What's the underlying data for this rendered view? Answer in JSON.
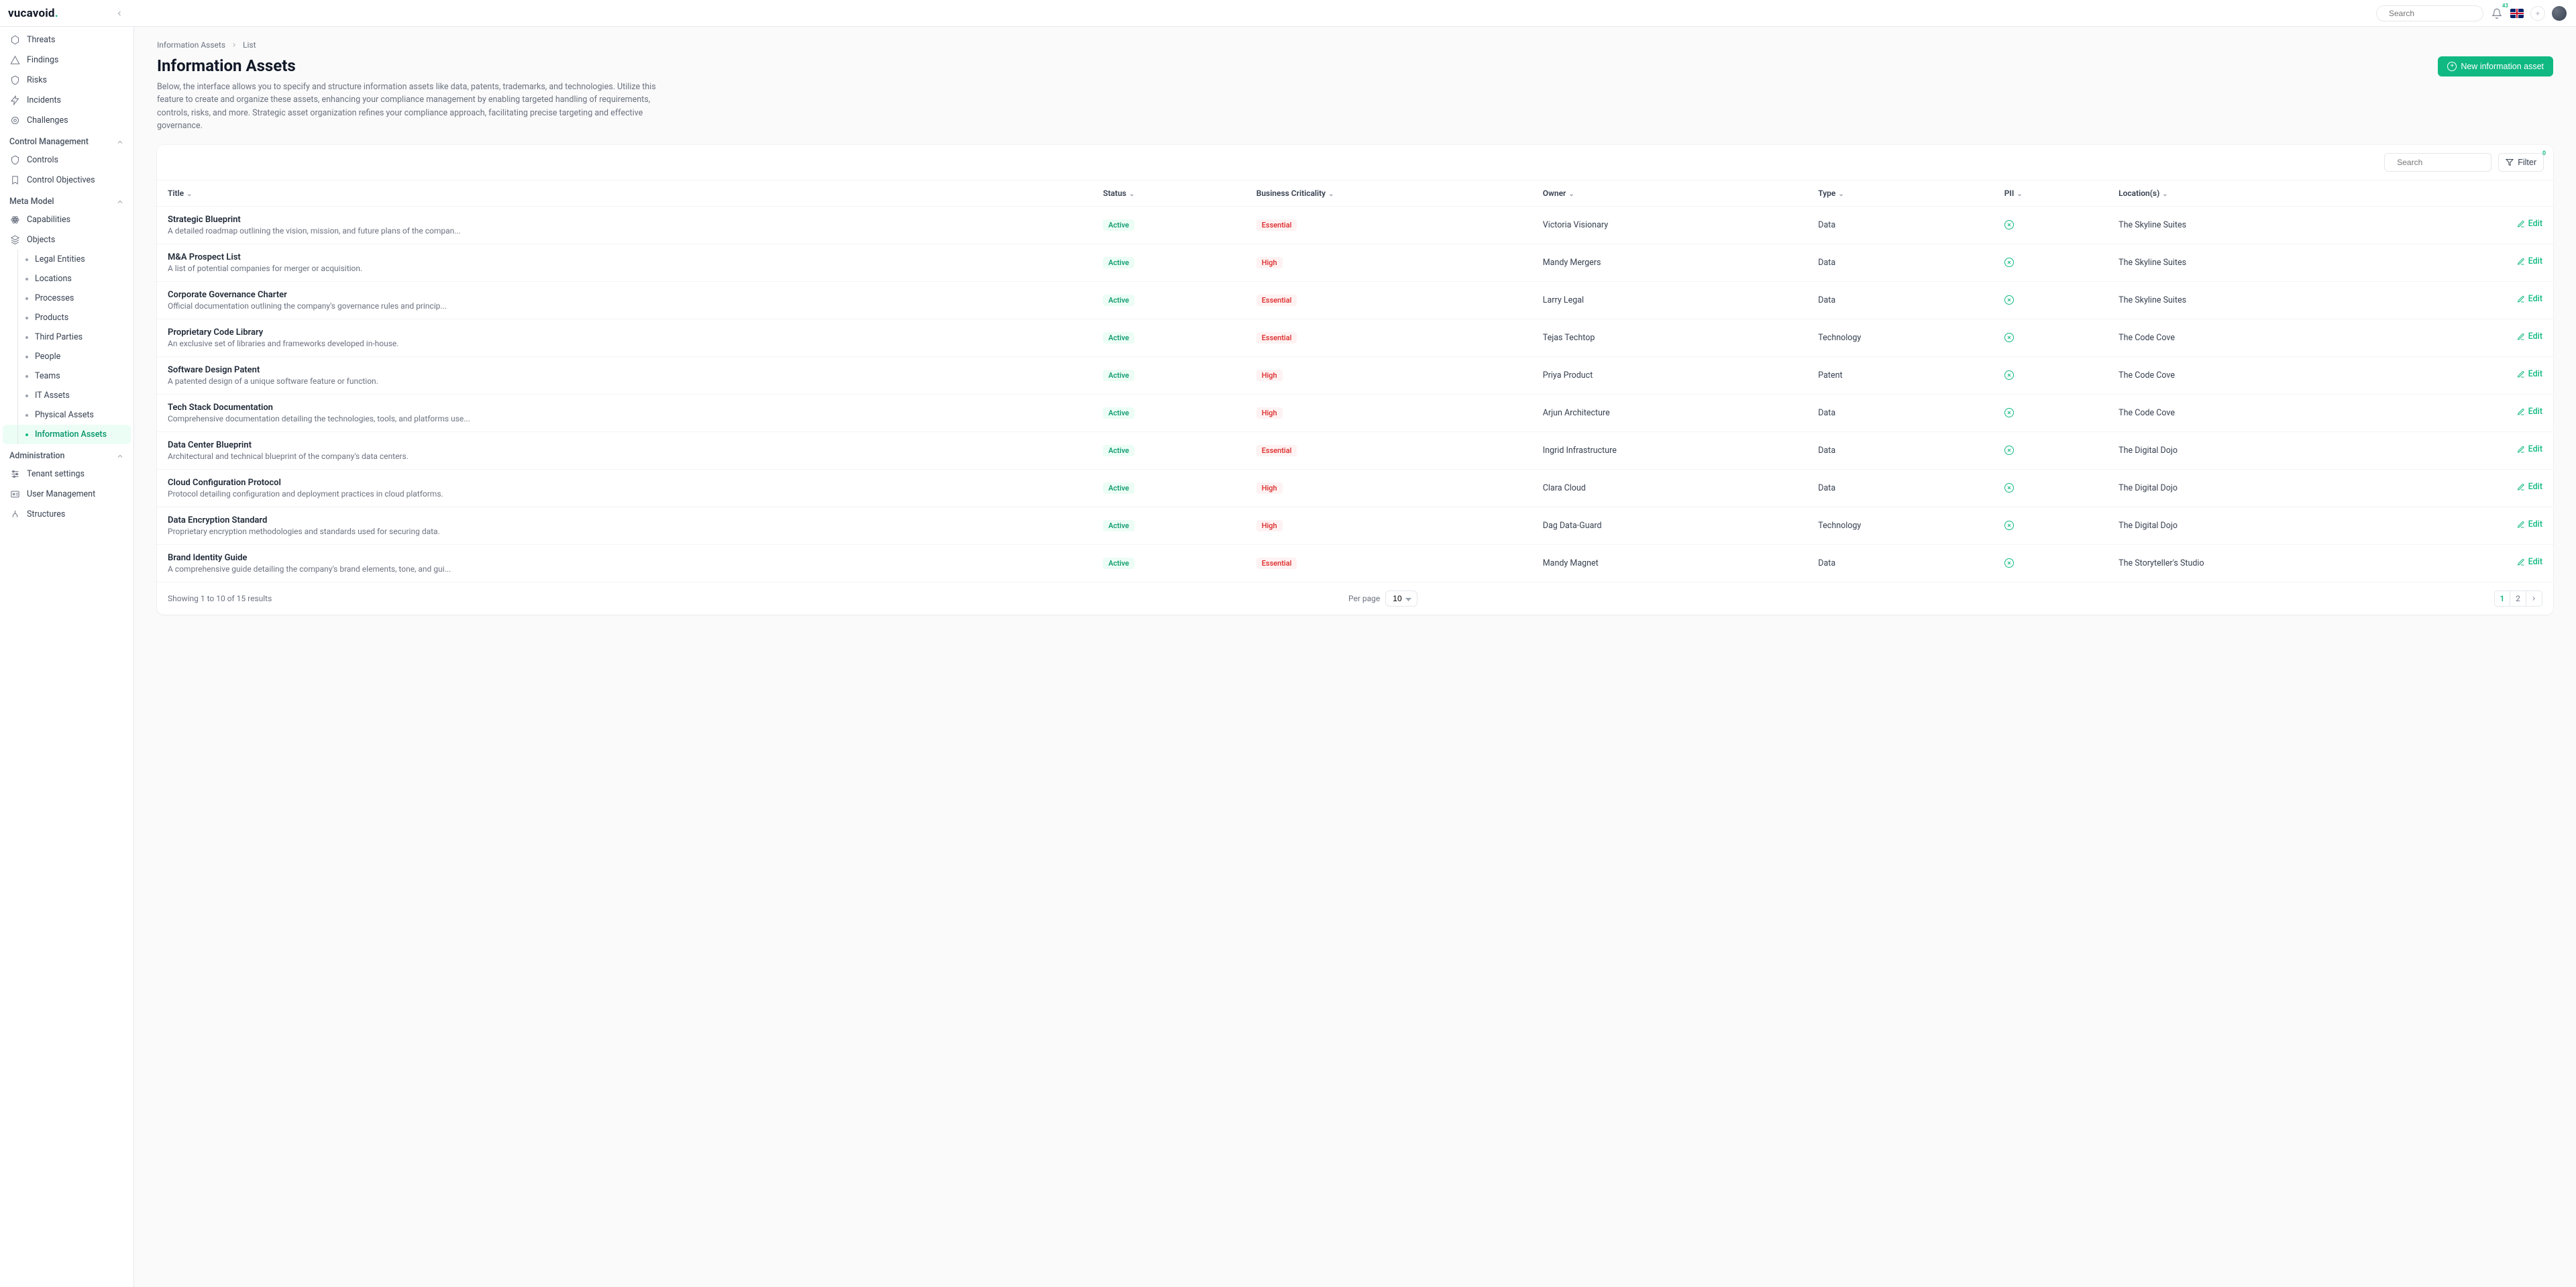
{
  "brand": "vucavoid",
  "topbar": {
    "search_placeholder": "Search",
    "notification_count": "43"
  },
  "sidebar": {
    "risk": [
      {
        "data_name": "sidebar-item-threats",
        "label": "Threats",
        "icon": "hex"
      },
      {
        "data_name": "sidebar-item-findings",
        "label": "Findings",
        "icon": "triangle"
      },
      {
        "data_name": "sidebar-item-risks",
        "label": "Risks",
        "icon": "shield"
      },
      {
        "data_name": "sidebar-item-incidents",
        "label": "Incidents",
        "icon": "bolt"
      },
      {
        "data_name": "sidebar-item-challenges",
        "label": "Challenges",
        "icon": "target"
      }
    ],
    "groups": [
      {
        "title": "Control Management",
        "items": [
          {
            "data_name": "sidebar-item-controls",
            "label": "Controls",
            "icon": "shield"
          },
          {
            "data_name": "sidebar-item-control-objectives",
            "label": "Control Objectives",
            "icon": "bookmark"
          }
        ]
      },
      {
        "title": "Meta Model",
        "items": [
          {
            "data_name": "sidebar-item-capabilities",
            "label": "Capabilities",
            "icon": "atom"
          },
          {
            "data_name": "sidebar-item-objects",
            "label": "Objects",
            "icon": "stack"
          }
        ],
        "subitems": [
          {
            "data_name": "sidebar-sub-legal",
            "label": "Legal Entities"
          },
          {
            "data_name": "sidebar-sub-locations",
            "label": "Locations"
          },
          {
            "data_name": "sidebar-sub-processes",
            "label": "Processes"
          },
          {
            "data_name": "sidebar-sub-products",
            "label": "Products"
          },
          {
            "data_name": "sidebar-sub-thirdparty",
            "label": "Third Parties"
          },
          {
            "data_name": "sidebar-sub-people",
            "label": "People"
          },
          {
            "data_name": "sidebar-sub-teams",
            "label": "Teams"
          },
          {
            "data_name": "sidebar-sub-itassets",
            "label": "IT Assets"
          },
          {
            "data_name": "sidebar-sub-physassets",
            "label": "Physical Assets"
          },
          {
            "data_name": "sidebar-sub-infoassets",
            "label": "Information Assets",
            "active": true
          }
        ]
      },
      {
        "title": "Administration",
        "items": [
          {
            "data_name": "sidebar-item-tenant",
            "label": "Tenant settings",
            "icon": "sliders"
          },
          {
            "data_name": "sidebar-item-usermgmt",
            "label": "User Management",
            "icon": "idcard"
          },
          {
            "data_name": "sidebar-item-structures",
            "label": "Structures",
            "icon": "tree"
          }
        ]
      }
    ]
  },
  "breadcrumbs": [
    "Information Assets",
    "List"
  ],
  "page": {
    "title": "Information Assets",
    "description": "Below, the interface allows you to specify and structure information assets like data, patents, trademarks, and technologies. Utilize this feature to create and organize these assets, enhancing your compliance management by enabling targeted handling of requirements, controls, risks, and more. Strategic asset organization refines your compliance approach, facilitating precise targeting and effective governance.",
    "new_button": "New information asset"
  },
  "table": {
    "search_placeholder": "Search",
    "filter_label": "Filter",
    "filter_count": "0",
    "columns": [
      "Title",
      "Status",
      "Business Criticality",
      "Owner",
      "Type",
      "PII",
      "Location(s)"
    ],
    "edit_label": "Edit",
    "rows": [
      {
        "title": "Strategic Blueprint",
        "subtitle": "A detailed roadmap outlining the vision, mission, and future plans of the compan...",
        "status": "Active",
        "criticality": "Essential",
        "owner": "Victoria Visionary",
        "type": "Data",
        "location": "The Skyline Suites"
      },
      {
        "title": "M&A Prospect List",
        "subtitle": "A list of potential companies for merger or acquisition.",
        "status": "Active",
        "criticality": "High",
        "owner": "Mandy Mergers",
        "type": "Data",
        "location": "The Skyline Suites"
      },
      {
        "title": "Corporate Governance Charter",
        "subtitle": "Official documentation outlining the company's governance rules and princip...",
        "status": "Active",
        "criticality": "Essential",
        "owner": "Larry Legal",
        "type": "Data",
        "location": "The Skyline Suites"
      },
      {
        "title": "Proprietary Code Library",
        "subtitle": "An exclusive set of libraries and frameworks developed in-house.",
        "status": "Active",
        "criticality": "Essential",
        "owner": "Tejas Techtop",
        "type": "Technology",
        "location": "The Code Cove"
      },
      {
        "title": "Software Design Patent",
        "subtitle": "A patented design of a unique software feature or function.",
        "status": "Active",
        "criticality": "High",
        "owner": "Priya Product",
        "type": "Patent",
        "location": "The Code Cove"
      },
      {
        "title": "Tech Stack Documentation",
        "subtitle": "Comprehensive documentation detailing the technologies, tools, and platforms use...",
        "status": "Active",
        "criticality": "High",
        "owner": "Arjun Architecture",
        "type": "Data",
        "location": "The Code Cove"
      },
      {
        "title": "Data Center Blueprint",
        "subtitle": "Architectural and technical blueprint of the company's data centers.",
        "status": "Active",
        "criticality": "Essential",
        "owner": "Ingrid Infrastructure",
        "type": "Data",
        "location": "The Digital Dojo"
      },
      {
        "title": "Cloud Configuration Protocol",
        "subtitle": "Protocol detailing configuration and deployment practices in cloud platforms.",
        "status": "Active",
        "criticality": "High",
        "owner": "Clara Cloud",
        "type": "Data",
        "location": "The Digital Dojo"
      },
      {
        "title": "Data Encryption Standard",
        "subtitle": "Proprietary encryption methodologies and standards used for securing data.",
        "status": "Active",
        "criticality": "High",
        "owner": "Dag Data-Guard",
        "type": "Technology",
        "location": "The Digital Dojo"
      },
      {
        "title": "Brand Identity Guide",
        "subtitle": "A comprehensive guide detailing the company's brand elements, tone, and gui...",
        "status": "Active",
        "criticality": "Essential",
        "owner": "Mandy Magnet",
        "type": "Data",
        "location": "The Storyteller's Studio"
      }
    ],
    "footer": {
      "summary": "Showing 1 to 10 of 15 results",
      "perpage_label": "Per page",
      "perpage_value": "10",
      "pages": [
        "1",
        "2"
      ],
      "active_page": "1"
    }
  }
}
